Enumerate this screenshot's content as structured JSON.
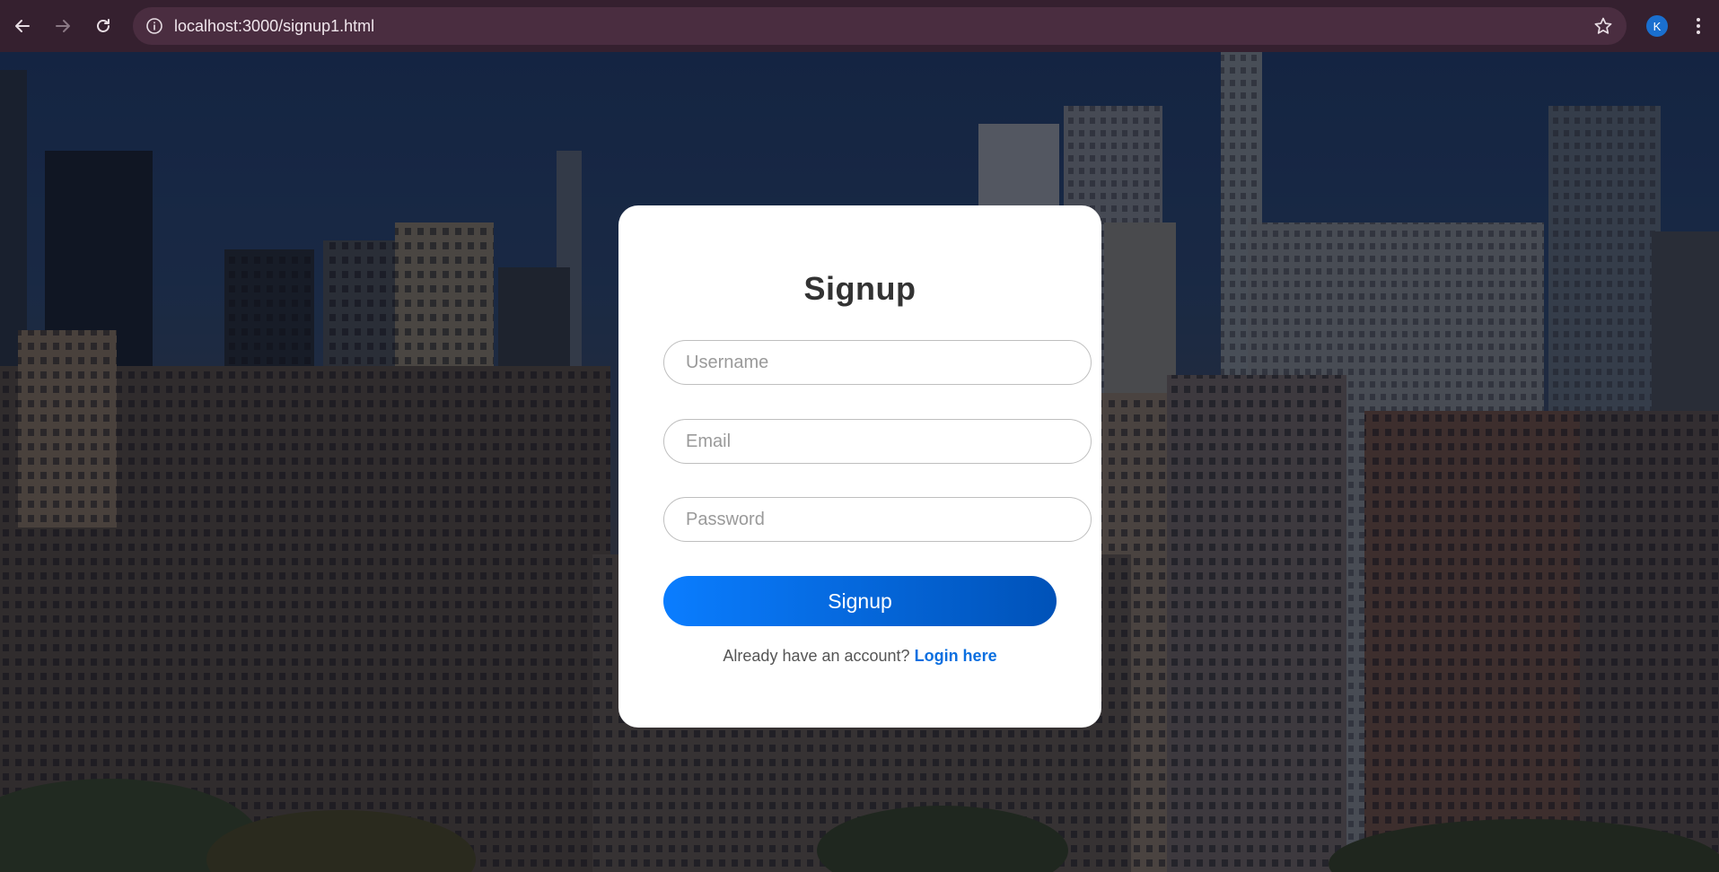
{
  "browser": {
    "url": "localhost:3000/signup1.html",
    "profile_initial": "K"
  },
  "form": {
    "title": "Signup",
    "username_placeholder": "Username",
    "email_placeholder": "Email",
    "password_placeholder": "Password",
    "submit_label": "Signup",
    "footer_text": "Already have an account?",
    "footer_link": "Login here"
  },
  "colors": {
    "button_start": "#0a7dff",
    "button_end": "#0052b8",
    "link": "#0a6fe0",
    "chrome": "#35202f"
  }
}
